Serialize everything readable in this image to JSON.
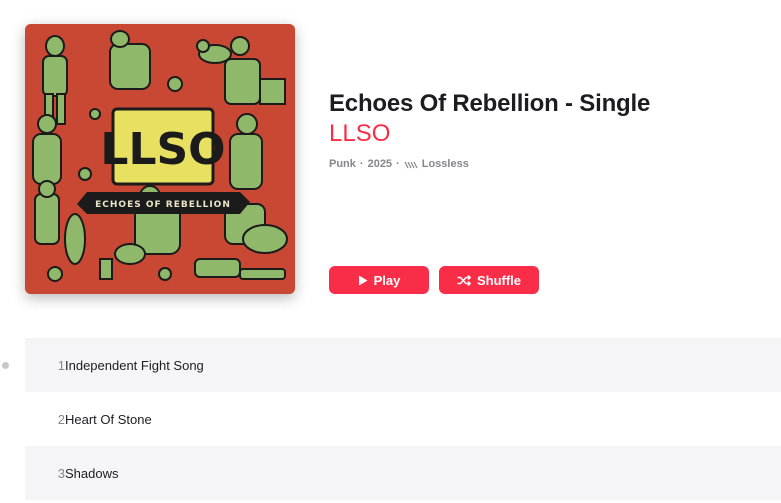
{
  "album": {
    "title": "Echoes Of Rebellion - Single",
    "artist": "LLSO",
    "genre": "Punk",
    "year": "2025",
    "quality": "Lossless",
    "separator": "·",
    "artwork_text": {
      "logo": "LLSO",
      "banner": "ECHOES OF REBELLION"
    }
  },
  "buttons": {
    "play_label": "Play",
    "shuffle_label": "Shuffle"
  },
  "tracks": [
    {
      "number": "1",
      "title": "Independent Fight Song"
    },
    {
      "number": "2",
      "title": "Heart Of Stone"
    },
    {
      "number": "3",
      "title": "Shadows"
    }
  ],
  "colors": {
    "accent": "#fa2d48",
    "artwork_bg": "#c94834",
    "artwork_figures": "#8fb86a",
    "row_alt": "#f5f5f7",
    "secondary_text": "#86868b"
  },
  "icons": {
    "play": "play-icon",
    "shuffle": "shuffle-icon",
    "lossless": "lossless-icon"
  }
}
